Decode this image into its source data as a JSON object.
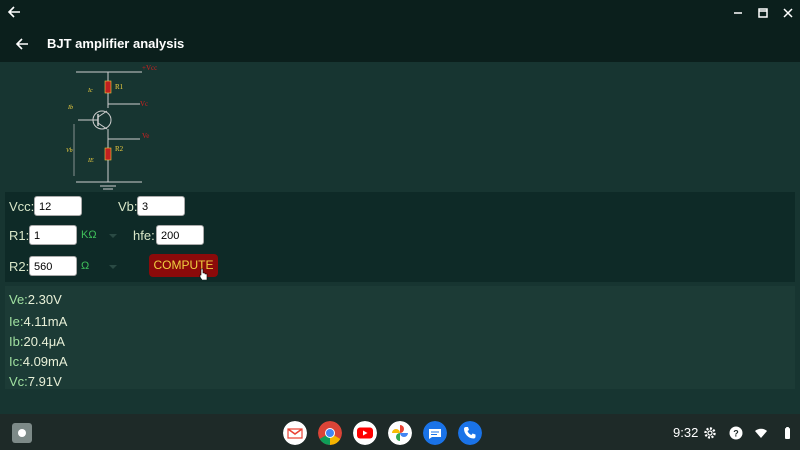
{
  "app": {
    "title": "BJT amplifier analysis"
  },
  "diagram": {
    "labels": {
      "vcc": "+Vcc",
      "r1": "R1",
      "vc": "Vc",
      "ve": "Ve",
      "r2": "R2",
      "ic": "Ic",
      "ib": "Ib",
      "vb": "Vb",
      "ie": "IE"
    }
  },
  "inputs": {
    "vcc": {
      "label": "Vcc:",
      "value": "12"
    },
    "vb": {
      "label": "Vb:",
      "value": "3"
    },
    "r1": {
      "label": "R1:",
      "value": "1",
      "unit": "KΩ"
    },
    "hfe": {
      "label": "hfe:",
      "value": "200"
    },
    "r2": {
      "label": "R2:",
      "value": "560",
      "unit": "Ω"
    },
    "compute": "COMPUTE"
  },
  "results": [
    {
      "name": "Ve:",
      "value": "2.30V"
    },
    {
      "name": "Ie:",
      "value": "4.11mA"
    },
    {
      "name": "Ib:",
      "value": "20.4μA"
    },
    {
      "name": "Ic:",
      "value": "4.09mA"
    },
    {
      "name": "Vc:",
      "value": "7.91V"
    }
  ],
  "taskbar": {
    "time": "9:32",
    "apps": [
      "gmail",
      "chrome",
      "youtube",
      "photos",
      "messages",
      "phone"
    ]
  }
}
